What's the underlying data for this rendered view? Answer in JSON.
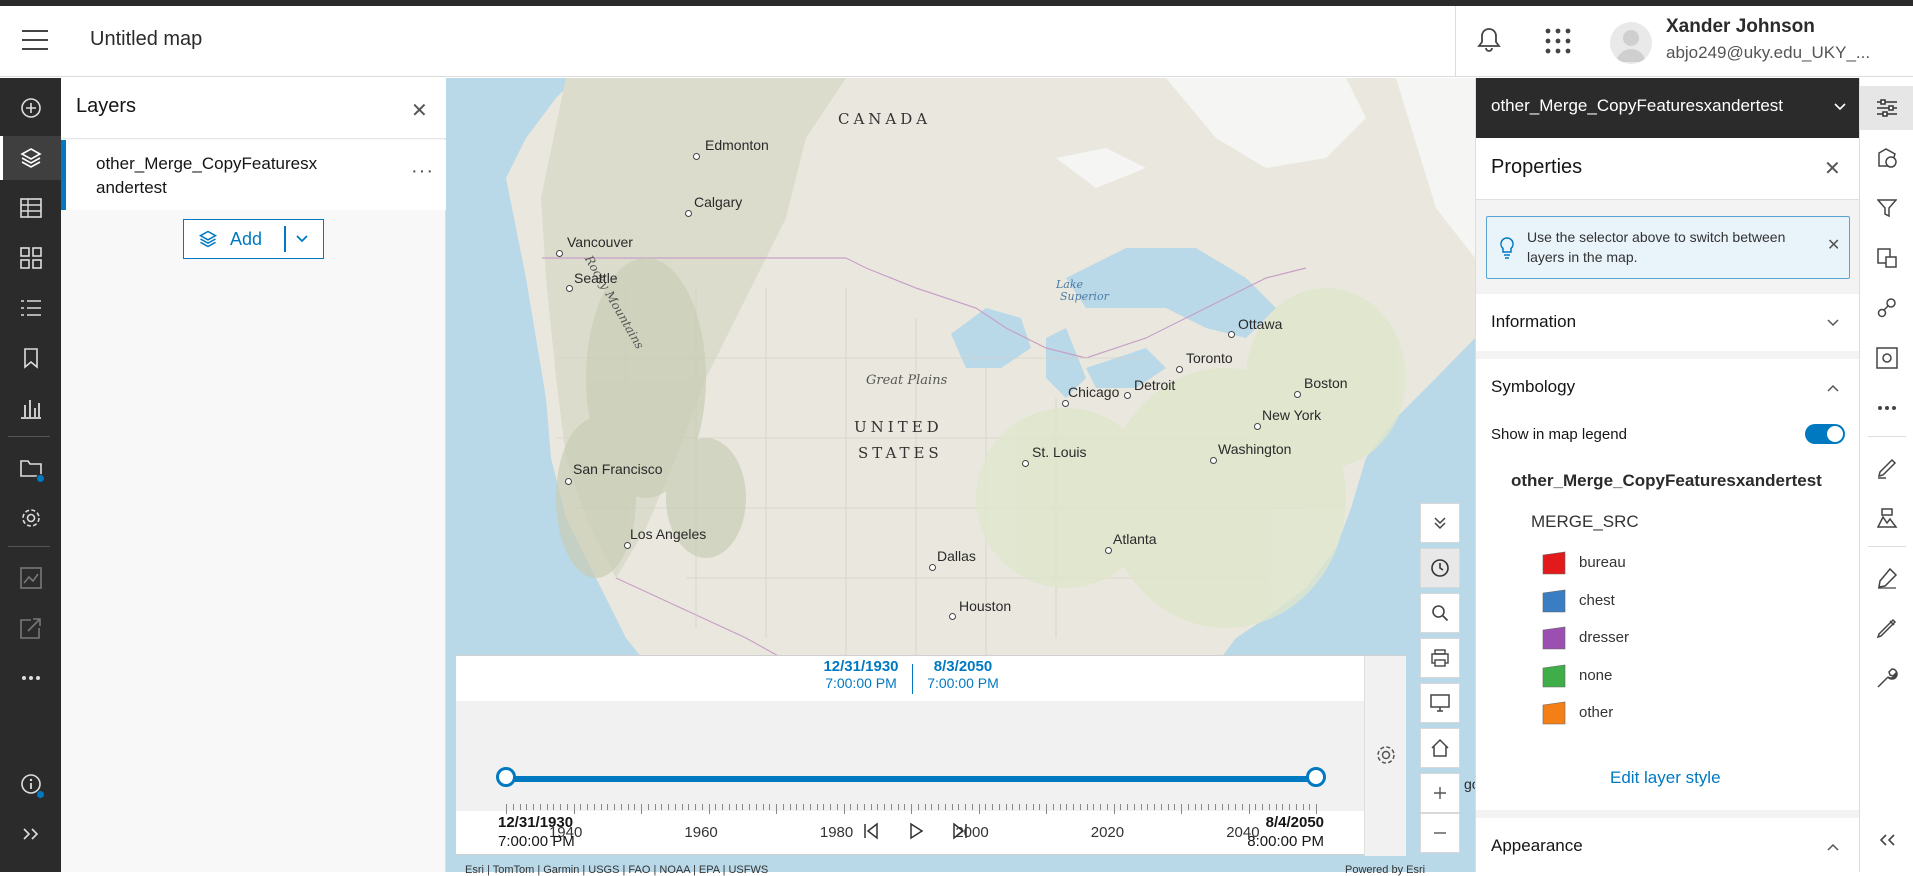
{
  "header": {
    "map_title": "Untitled map",
    "user_name": "Xander Johnson",
    "user_email": "abjo249@uky.edu_UKY_..."
  },
  "left_toolbar": {
    "icons": [
      "add-icon",
      "layers-icon",
      "table-icon",
      "basemap-icon",
      "legend-icon",
      "bookmark-icon",
      "charts-icon",
      "folder-icon",
      "settings-icon",
      "analysis-icon",
      "share-icon",
      "more-icon",
      "info-icon",
      "expand-icon"
    ]
  },
  "layers_panel": {
    "title": "Layers",
    "close": "✕",
    "layer_name": "other_Merge_CopyFeaturesxandertest",
    "more": "···",
    "add_label": "Add"
  },
  "map": {
    "labels": {
      "canada": "CANADA",
      "united": "UNITED",
      "states": "STATES",
      "great_plains": "Great Plains",
      "rocky": "Rocky Mountains",
      "lake_superior_1": "Lake",
      "lake_superior_2": "Superior",
      "edmonton": "Edmonton",
      "calgary": "Calgary",
      "vancouver": "Vancouver",
      "seattle": "Seattle",
      "san_francisco": "San Francisco",
      "los_angeles": "Los Angeles",
      "dallas": "Dallas",
      "houston": "Houston",
      "chicago": "Chicago",
      "detroit": "Detroit",
      "toronto": "Toronto",
      "ottawa": "Ottawa",
      "boston": "Boston",
      "new_york": "New York",
      "washington": "Washington",
      "st_louis": "St. Louis",
      "atlanta": "Atlanta",
      "partial_right": "go"
    },
    "attribution": "Esri | TomTom | Garmin | USGS | FAO | NOAA | EPA | USFWS",
    "powered": "Powered by Esri"
  },
  "time_slider": {
    "range_start_date": "12/31/1930",
    "range_start_time": "7:00:00 PM",
    "range_end_date": "8/3/2050",
    "range_end_time": "7:00:00 PM",
    "years": [
      "1940",
      "1960",
      "1980",
      "2000",
      "2020",
      "2040"
    ],
    "min_date": "12/31/1930",
    "min_time": "7:00:00 PM",
    "max_date": "8/4/2050",
    "max_time": "8:00:00 PM",
    "start_fraction": 0.0,
    "end_fraction": 1.0
  },
  "properties_panel": {
    "layer_selector": "other_Merge_CopyFeaturesxandertest",
    "title": "Properties",
    "notice": "Use the selector above to switch between layers in the map.",
    "information": "Information",
    "symbology": "Symbology",
    "show_in_legend": "Show in map legend",
    "show_in_legend_on": true,
    "legend_layer": "other_Merge_CopyFeaturesxandertest",
    "field": "MERGE_SRC",
    "classes": [
      {
        "label": "bureau",
        "color": "#e31a1c"
      },
      {
        "label": "chest",
        "color": "#3a7dc2"
      },
      {
        "label": "dresser",
        "color": "#9b4fb0"
      },
      {
        "label": "none",
        "color": "#3fae49"
      },
      {
        "label": "other",
        "color": "#f57f17"
      }
    ],
    "edit_style": "Edit layer style",
    "appearance": "Appearance"
  },
  "right_toolbar": {
    "icons": [
      "properties-icon",
      "styles-icon",
      "filter-icon",
      "effects-icon",
      "pop-ups-icon",
      "configure-icon",
      "more-icon",
      "sketch-icon",
      "labels-icon",
      "edit-icon",
      "draw-icon",
      "tools-icon",
      "collapse-icon"
    ]
  }
}
